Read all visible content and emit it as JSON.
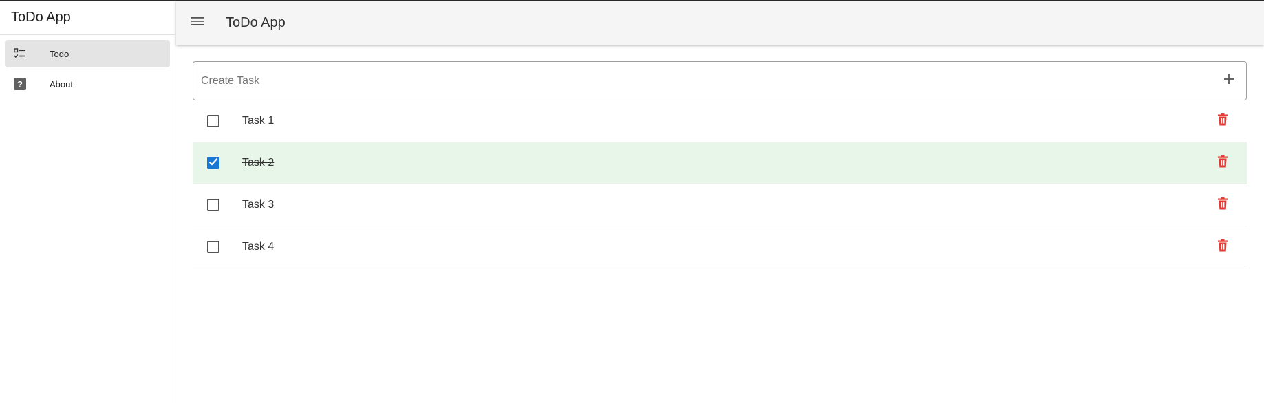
{
  "sidebar": {
    "title": "ToDo App",
    "items": [
      {
        "label": "Todo",
        "icon": "checklist-icon",
        "active": true
      },
      {
        "label": "About",
        "icon": "help-icon",
        "active": false
      }
    ]
  },
  "header": {
    "title": "ToDo App",
    "menu_icon": "menu-icon"
  },
  "create_task": {
    "placeholder": "Create Task",
    "value": "",
    "add_icon": "plus-icon"
  },
  "tasks": [
    {
      "label": "Task 1",
      "completed": false
    },
    {
      "label": "Task 2",
      "completed": true
    },
    {
      "label": "Task 3",
      "completed": false
    },
    {
      "label": "Task 4",
      "completed": false
    }
  ],
  "colors": {
    "accent": "#1976d2",
    "completed_row": "#e8f5e9",
    "delete": "#e53935",
    "header_bg": "#f5f5f5"
  }
}
